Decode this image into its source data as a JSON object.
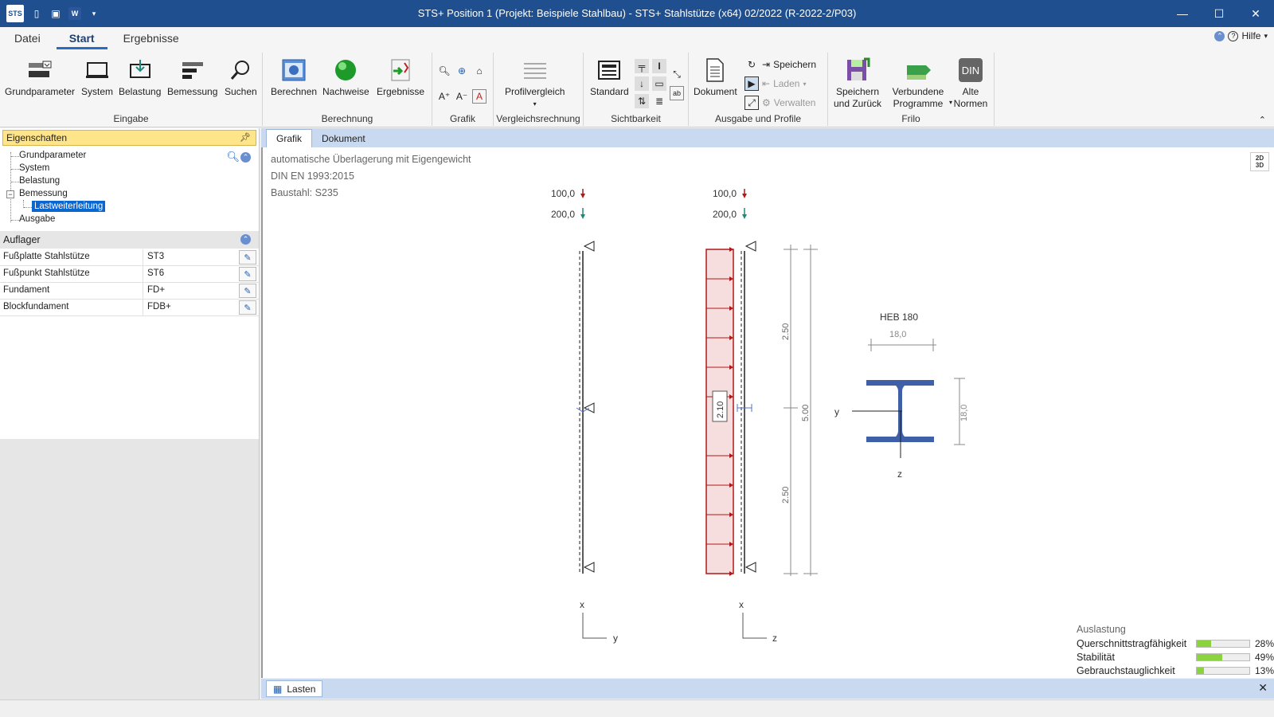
{
  "window": {
    "title": "STS+ Position 1 (Projekt: Beispiele Stahlbau) - STS+ Stahlstütze (x64) 02/2022 (R-2022-2/P03)",
    "logo": "STS",
    "minimize": "—",
    "maximize": "☐",
    "close": "✕"
  },
  "ribbon_tabs": [
    "Datei",
    "Start",
    "Ergebnisse"
  ],
  "help": {
    "label": "Hilfe",
    "chevron": "▾"
  },
  "ribbon": {
    "eingabe": {
      "label": "Eingabe",
      "buttons": [
        "Grundparameter",
        "System",
        "Belastung",
        "Bemessung",
        "Suchen"
      ]
    },
    "berechnung": {
      "label": "Berechnung",
      "buttons": [
        "Berechnen",
        "Nachweise",
        "Ergebnisse"
      ]
    },
    "grafik": {
      "label": "Grafik"
    },
    "vergleich": {
      "label": "Vergleichsrechnung",
      "buttons": [
        "Profilvergleich"
      ]
    },
    "sichtbarkeit": {
      "label": "Sichtbarkeit",
      "buttons": [
        "Standard"
      ]
    },
    "ausgabe": {
      "label": "Ausgabe und Profile",
      "buttons": [
        "Dokument"
      ],
      "small": [
        "Speichern",
        "Laden",
        "Verwalten"
      ]
    },
    "frilo": {
      "label": "Frilo",
      "buttons": [
        "Speichern und Zurück",
        "Verbundene Programme",
        "Alte Normen"
      ],
      "din_badge": "DIN"
    }
  },
  "properties": {
    "title": "Eigenschaften",
    "tree": [
      "Grundparameter",
      "System",
      "Belastung",
      "Bemessung",
      "Lastweiterleitung",
      "Ausgabe"
    ],
    "auflager_title": "Auflager",
    "rows": [
      {
        "name": "Fußplatte Stahlstütze",
        "value": "ST3"
      },
      {
        "name": "Fußpunkt Stahlstütze",
        "value": "ST6"
      },
      {
        "name": "Fundament",
        "value": "FD+"
      },
      {
        "name": "Blockfundament",
        "value": "FDB+"
      }
    ]
  },
  "main_tabs": [
    "Grafik",
    "Dokument"
  ],
  "canvas": {
    "info": [
      "automatische Überlagerung mit Eigengewicht",
      "DIN EN 1993:2015",
      "Baustahl: S235"
    ],
    "view_toggle": [
      "2D",
      "3D"
    ],
    "loads_left": [
      "100,0",
      "200,0"
    ],
    "loads_right": [
      "100,0",
      "200,0"
    ],
    "dim_upper": "2.50",
    "dim_lower": "2.50",
    "dim_total": "5.00",
    "dist_load": "2.10",
    "axes_left": {
      "a": "x",
      "b": "y"
    },
    "axes_right": {
      "a": "x",
      "b": "z"
    },
    "profile": {
      "name": "HEB 180",
      "width": "18,0",
      "height": "18,0",
      "axis_y": "y",
      "axis_z": "z"
    }
  },
  "auslastung": {
    "title": "Auslastung",
    "items": [
      {
        "name": "Querschnittstragfähigkeit",
        "value": "28%",
        "fraction": 0.28
      },
      {
        "name": "Stabilität",
        "value": "49%",
        "fraction": 0.49
      },
      {
        "name": "Gebrauchstauglichkeit",
        "value": "13%",
        "fraction": 0.13
      }
    ]
  },
  "bottom_tab": "Lasten",
  "colors": {
    "titlebar": "#1f4f8f",
    "profile": "#3f5fa8",
    "load": "#b01818",
    "selection": "#0a66d1",
    "accent_tab": "#2a6bc4"
  }
}
